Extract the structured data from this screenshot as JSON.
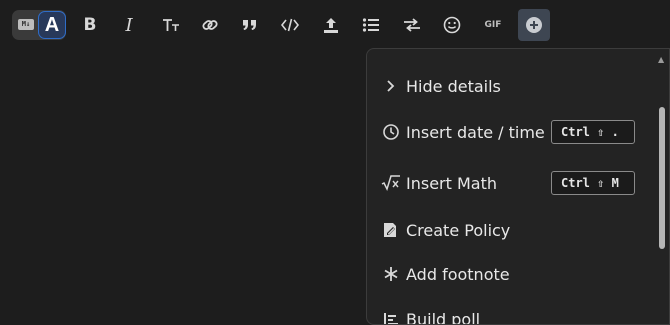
{
  "toolbar": {
    "mode_toggle": {
      "markdown_label": "M↓",
      "rich_label": "A"
    },
    "buttons": [
      {
        "name": "bold",
        "glyph": "B"
      },
      {
        "name": "italic",
        "glyph": "I"
      },
      {
        "name": "heading",
        "glyph": "Tт"
      },
      {
        "name": "link",
        "icon": "link-icon"
      },
      {
        "name": "quote",
        "glyph": "❞"
      },
      {
        "name": "code",
        "icon": "code-icon"
      },
      {
        "name": "upload",
        "icon": "upload-icon"
      },
      {
        "name": "bullet-list",
        "icon": "list-icon"
      },
      {
        "name": "swap",
        "icon": "arrows-swap-icon"
      },
      {
        "name": "emoji",
        "icon": "smiley-icon"
      },
      {
        "name": "gif",
        "label": "GIF"
      },
      {
        "name": "more",
        "icon": "plus-circle-icon"
      }
    ]
  },
  "menu": {
    "items": [
      {
        "icon": "chevron-right-icon",
        "label": "Hide details"
      },
      {
        "icon": "clock-icon",
        "label": "Insert date / time",
        "shortcut": "Ctrl ⇧ ."
      },
      {
        "icon": "sqrt-icon",
        "label": "Insert Math",
        "shortcut": "Ctrl ⇧ M"
      },
      {
        "icon": "policy-icon",
        "label": "Create Policy"
      },
      {
        "icon": "asterisk-icon",
        "label": "Add footnote"
      },
      {
        "icon": "poll-icon",
        "label": "Build poll"
      }
    ]
  }
}
